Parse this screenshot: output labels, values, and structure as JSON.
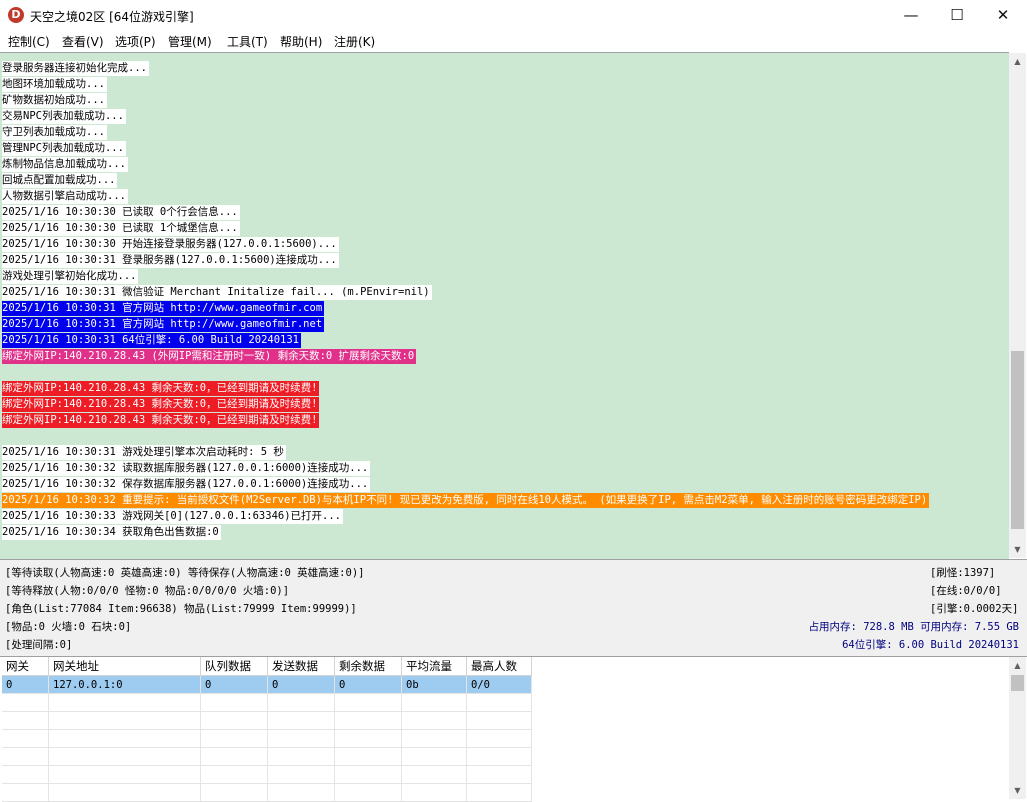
{
  "window": {
    "title": "天空之境02区 [64位游戏引擎]",
    "app_icon_letter": "D",
    "minimize": "—",
    "maximize": "☐",
    "close": "✕"
  },
  "menu": [
    "控制(C)",
    "查看(V)",
    "选项(P)",
    "管理(M)",
    "工具(T)",
    "帮助(H)",
    "注册(K)"
  ],
  "log": [
    {
      "text": "登录服务器连接初始化完成...",
      "style": "plain"
    },
    {
      "text": "地图环境加载成功...",
      "style": "plain"
    },
    {
      "text": "矿物数据初始成功...",
      "style": "plain"
    },
    {
      "text": "交易NPC列表加载成功...",
      "style": "plain"
    },
    {
      "text": "守卫列表加载成功...",
      "style": "plain"
    },
    {
      "text": "管理NPC列表加载成功...",
      "style": "plain"
    },
    {
      "text": "炼制物品信息加载成功...",
      "style": "plain"
    },
    {
      "text": "回城点配置加载成功...",
      "style": "plain"
    },
    {
      "text": "人物数据引擎启动成功...",
      "style": "plain"
    },
    {
      "text": "2025/1/16 10:30:30 已读取 0个行会信息...",
      "style": "plain"
    },
    {
      "text": "2025/1/16 10:30:30 已读取 1个城堡信息...",
      "style": "plain"
    },
    {
      "text": "2025/1/16 10:30:30 开始连接登录服务器(127.0.0.1:5600)...",
      "style": "plain"
    },
    {
      "text": "2025/1/16 10:30:31 登录服务器(127.0.0.1:5600)连接成功...",
      "style": "plain"
    },
    {
      "text": "游戏处理引擎初始化成功...",
      "style": "plain"
    },
    {
      "text": "2025/1/16 10:30:31 微信验证 Merchant Initalize fail... (m.PEnvir=nil)",
      "style": "plain"
    },
    {
      "text": "2025/1/16 10:30:31 官方网站 http://www.gameofmir.com",
      "style": "blue"
    },
    {
      "text": "2025/1/16 10:30:31 官方网站 http://www.gameofmir.net",
      "style": "blue"
    },
    {
      "text": "2025/1/16 10:30:31 64位引擎: 6.00 Build 20240131",
      "style": "blue"
    },
    {
      "text": "绑定外网IP:140.210.28.43 (外网IP需和注册时一致) 剩余天数:0 扩展剩余天数:0",
      "style": "pink"
    },
    {
      "text": "",
      "style": "none"
    },
    {
      "text": "绑定外网IP:140.210.28.43 剩余天数:0，已经到期请及时续费!",
      "style": "red"
    },
    {
      "text": "绑定外网IP:140.210.28.43 剩余天数:0，已经到期请及时续费!",
      "style": "red"
    },
    {
      "text": "绑定外网IP:140.210.28.43 剩余天数:0，已经到期请及时续费!",
      "style": "red"
    },
    {
      "text": "",
      "style": "none"
    },
    {
      "text": "2025/1/16 10:30:31 游戏处理引擎本次启动耗时: 5 秒",
      "style": "plain"
    },
    {
      "text": "2025/1/16 10:30:32 读取数据库服务器(127.0.0.1:6000)连接成功...",
      "style": "plain"
    },
    {
      "text": "2025/1/16 10:30:32 保存数据库服务器(127.0.0.1:6000)连接成功...",
      "style": "plain"
    },
    {
      "text": "2025/1/16 10:30:32 重要提示: 当前授权文件(M2Server.DB)与本机IP不同! 现已更改为免费版, 同时在线10人模式。 (如果更换了IP, 需点击M2菜单, 输入注册时的账号密码更改绑定IP)",
      "style": "orange"
    },
    {
      "text": "2025/1/16 10:30:33 游戏网关[0](127.0.0.1:63346)已打开...",
      "style": "plain"
    },
    {
      "text": "2025/1/16 10:30:34 获取角色出售数据:0",
      "style": "plain"
    }
  ],
  "status": {
    "left": [
      "[等待读取(人物高速:0 英雄高速:0) 等待保存(人物高速:0 英雄高速:0)]",
      "[等待释放(人物:0/0/0 怪物:0 物品:0/0/0/0 火墙:0)]",
      "[角色(List:77084 Item:96638) 物品(List:79999 Item:99999)]",
      "[物品:0 火墙:0 石块:0]",
      "[处理间隔:0]"
    ],
    "refresh": "[刷怪:1397]",
    "online": "[在线:0/0/0]",
    "engine": "[引擎:0.0002天]",
    "memory": "占用内存: 728.8 MB  可用内存: 7.55 GB",
    "build": "64位引擎: 6.00 Build 20240131"
  },
  "gateway_table": {
    "headers": [
      "网关",
      "网关地址",
      "队列数据",
      "发送数据",
      "剩余数据",
      "平均流量",
      "最高人数"
    ],
    "rows": [
      [
        "0",
        "127.0.0.1:0",
        "0",
        "0",
        "0",
        "0b",
        "0/0"
      ]
    ]
  },
  "colors": {
    "log_bg": "#cde8d2",
    "blue": "#0000ee",
    "pink": "#e0308a",
    "red": "#ee1c24",
    "orange": "#ff8c00",
    "selected_row": "#9ecbf0"
  }
}
